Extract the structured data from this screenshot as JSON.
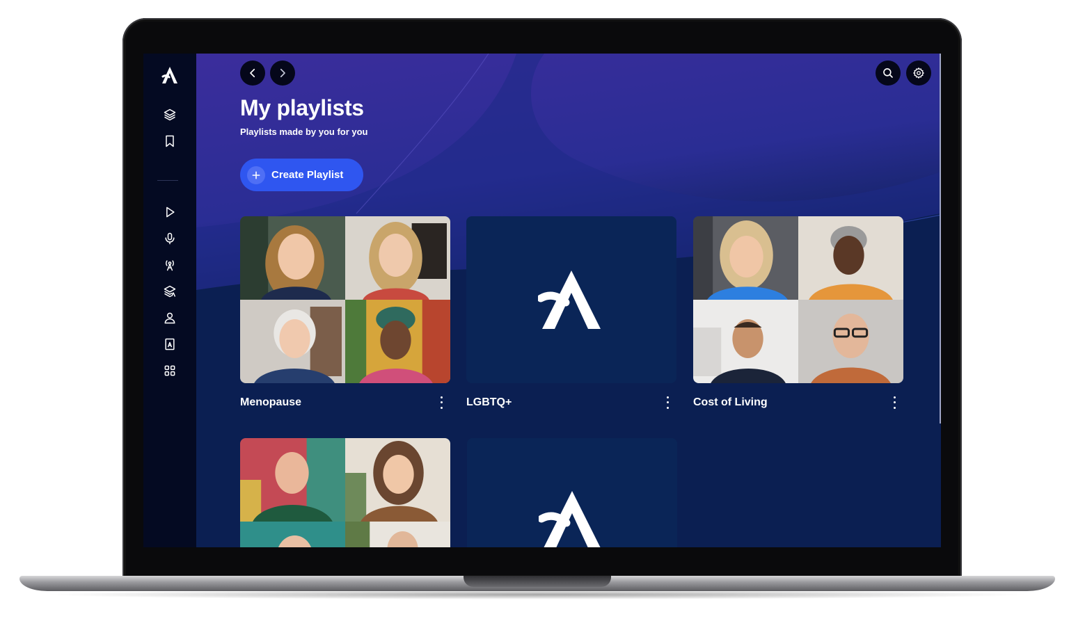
{
  "header": {
    "title": "My playlists",
    "subtitle": "Playlists made by you for you",
    "create_label": "Create Playlist"
  },
  "sidebar": {
    "items": [
      {
        "icon": "layers-icon"
      },
      {
        "icon": "bookmark-icon"
      },
      {
        "icon": "play-icon"
      },
      {
        "icon": "microphone-icon"
      },
      {
        "icon": "broadcast-icon"
      },
      {
        "icon": "learning-stack-icon"
      },
      {
        "icon": "person-icon"
      },
      {
        "icon": "book-icon"
      },
      {
        "icon": "grid-icon"
      }
    ]
  },
  "toolbar": {
    "back_icon": "chevron-left-icon",
    "forward_icon": "chevron-right-icon",
    "search_icon": "search-icon",
    "settings_icon": "gear-icon"
  },
  "playlists": [
    {
      "name": "Menopause",
      "cover": "faces"
    },
    {
      "name": "LGBTQ+",
      "cover": "logo"
    },
    {
      "name": "Cost of Living",
      "cover": "faces"
    },
    {
      "name": "",
      "cover": "faces"
    },
    {
      "name": "",
      "cover": "logo"
    }
  ],
  "colors": {
    "accent": "#2f56f0",
    "hero_top": "#3b2d9c",
    "background": "#0b1f52",
    "sidebar": "#040a22"
  }
}
